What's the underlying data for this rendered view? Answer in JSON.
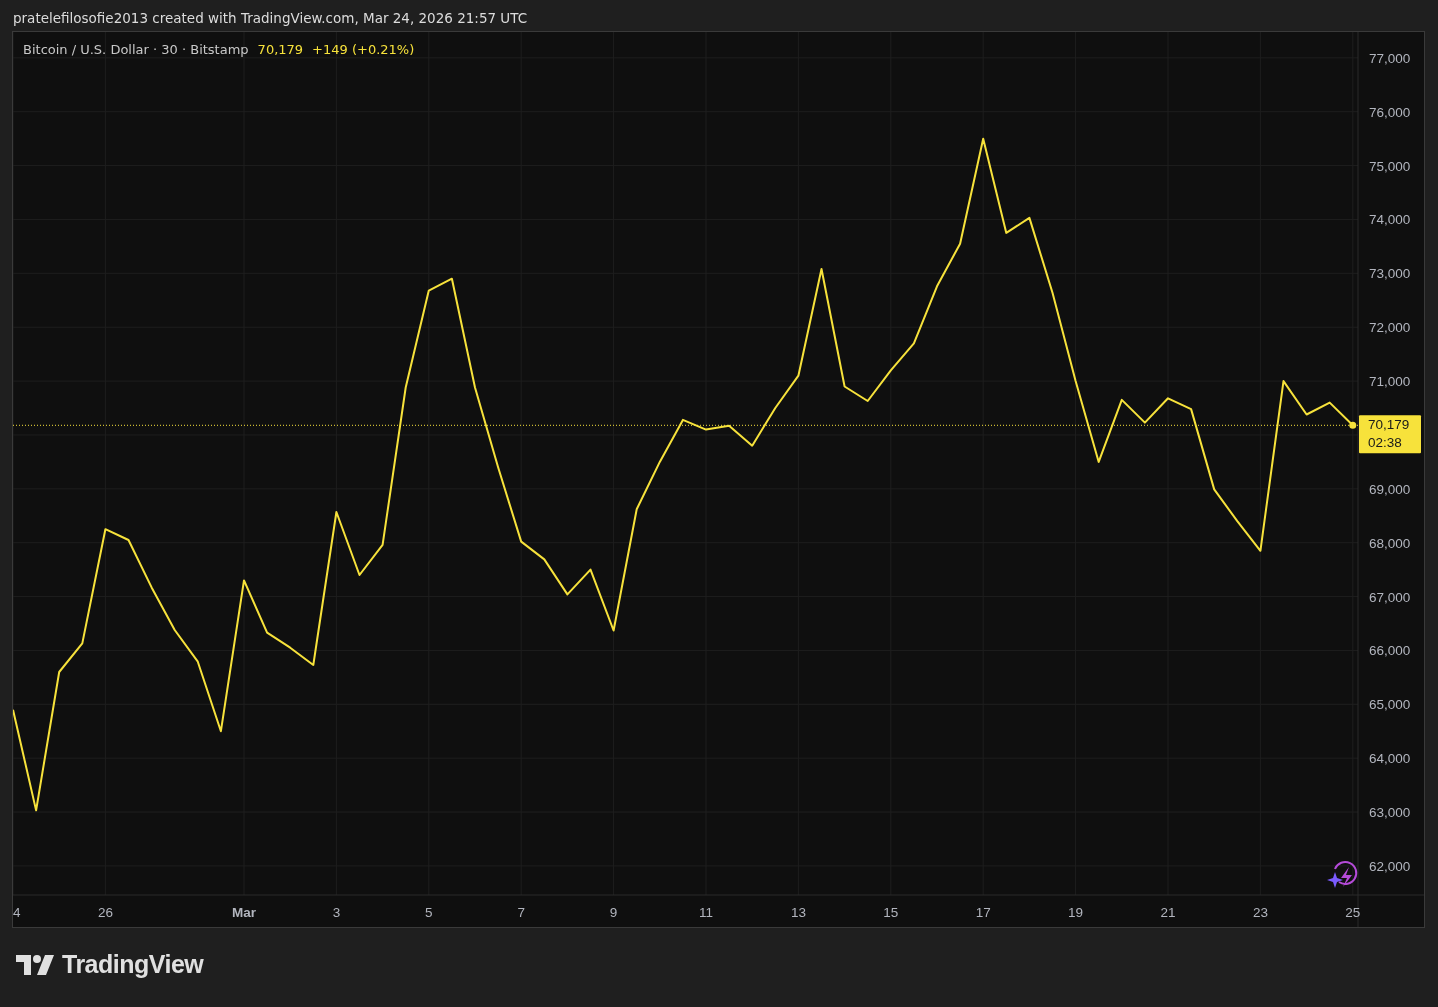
{
  "header": {
    "caption": "pratelefilosofie2013 created with TradingView.com, Mar 24, 2026 21:57 UTC"
  },
  "legend": {
    "symbol": "Bitcoin / U.S. Dollar · 30 · Bitstamp",
    "price": "70,179",
    "change": "+149 (+0.21%)"
  },
  "chart": {
    "last_price": "70,179",
    "countdown": "02:38",
    "chart_data": {
      "type": "line",
      "grid": true,
      "ylim": [
        61460,
        77480
      ],
      "ref_lines": [
        {
          "axis": "y",
          "value": 70179,
          "color": "#f7e23b"
        }
      ],
      "categories": [
        "4",
        null,
        null,
        null,
        "26",
        null,
        null,
        null,
        null,
        null,
        "Mar",
        null,
        null,
        null,
        "3",
        null,
        null,
        null,
        "5",
        null,
        null,
        null,
        "7",
        null,
        null,
        null,
        "9",
        null,
        null,
        null,
        "11",
        null,
        null,
        null,
        "13",
        null,
        null,
        null,
        "15",
        null,
        null,
        null,
        "17",
        null,
        null,
        null,
        "19",
        null,
        null,
        null,
        "21",
        null,
        null,
        null,
        "23",
        null,
        null,
        null,
        "25"
      ],
      "yticks": [
        {
          "value": 62000,
          "label": "62,000"
        },
        {
          "value": 63000,
          "label": "63,000"
        },
        {
          "value": 64000,
          "label": "64,000"
        },
        {
          "value": 65000,
          "label": "65,000"
        },
        {
          "value": 66000,
          "label": "66,000"
        },
        {
          "value": 67000,
          "label": "67,000"
        },
        {
          "value": 68000,
          "label": "68,000"
        },
        {
          "value": 69000,
          "label": "69,000"
        },
        {
          "value": 71000,
          "label": "71,000"
        },
        {
          "value": 72000,
          "label": "72,000"
        },
        {
          "value": 73000,
          "label": "73,000"
        },
        {
          "value": 74000,
          "label": "74,000"
        },
        {
          "value": 75000,
          "label": "75,000"
        },
        {
          "value": 76000,
          "label": "76,000"
        },
        {
          "value": 77000,
          "label": "77,000"
        }
      ],
      "series": [
        {
          "color": "#f7e23b",
          "values": [
            64900,
            63030,
            65600,
            66130,
            68250,
            68050,
            67170,
            66380,
            65790,
            64500,
            67300,
            66330,
            66050,
            65730,
            68570,
            67400,
            67960,
            70880,
            72680,
            72900,
            70880,
            69400,
            68020,
            67690,
            67040,
            67500,
            66370,
            68620,
            69500,
            70280,
            70100,
            70170,
            69800,
            70500,
            71100,
            73080,
            70900,
            70630,
            71200,
            71700,
            72760,
            73550,
            75500,
            73750,
            74030,
            72640,
            71000,
            69500,
            70650,
            70230,
            70680,
            70480,
            68990,
            68400,
            67850,
            71000,
            70380,
            70600,
            70180
          ]
        }
      ]
    }
  },
  "footer": {
    "brand": "TradingView"
  }
}
